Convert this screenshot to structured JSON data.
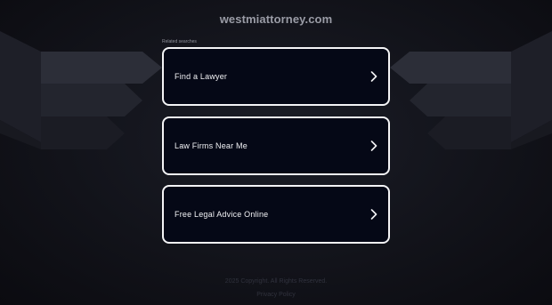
{
  "header": {
    "domain": "westmiattorney.com"
  },
  "related": {
    "label": "Related searches",
    "items": [
      {
        "label": "Find a Lawyer",
        "icon": "chevron-right-icon"
      },
      {
        "label": "Law Firms Near Me",
        "icon": "chevron-right-icon"
      },
      {
        "label": "Free Legal Advice Online",
        "icon": "chevron-right-icon"
      }
    ]
  },
  "footer": {
    "terms_text": "2025 Copyright. All Rights Reserved.",
    "privacy_link": "Privacy Policy"
  },
  "colors": {
    "background": "#12131a",
    "card_background": "#050816",
    "card_border": "#f4f4f6",
    "card_text": "#f2f2f5",
    "title_text": "#9a9ca6"
  }
}
